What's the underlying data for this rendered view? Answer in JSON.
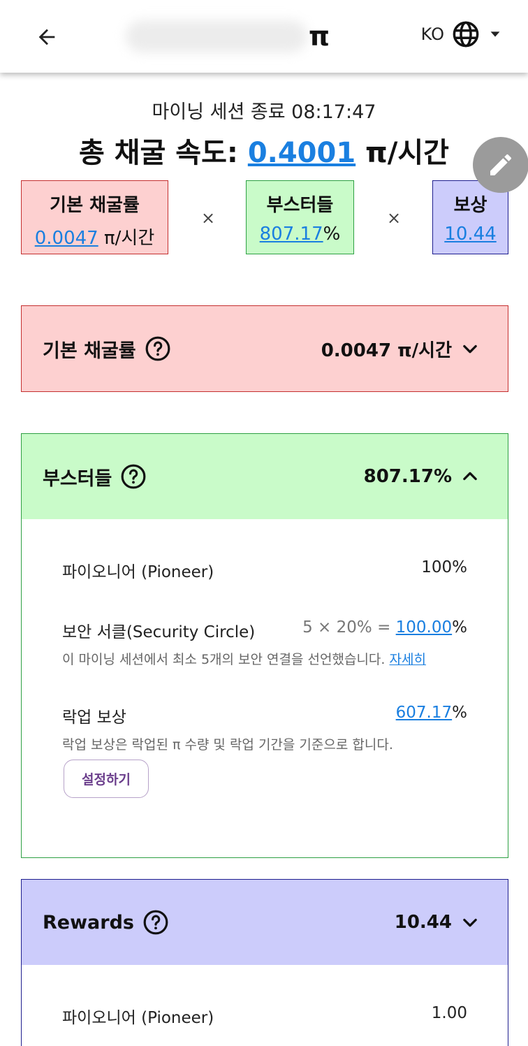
{
  "header": {
    "balance_suffix": "π",
    "language": "KO"
  },
  "session": {
    "text": "마이닝 세션 종료 08:17:47"
  },
  "total": {
    "label": "총 채굴 속도:",
    "value": "0.4001",
    "unit": "π/시간"
  },
  "summary": {
    "base": {
      "title": "기본 채굴률",
      "value": "0.0047",
      "unit": "π/시간"
    },
    "boosters": {
      "title": "부스터들",
      "value": "807.17",
      "unit": "%"
    },
    "rewards": {
      "title": "보상",
      "value": "10.44"
    },
    "times": "×"
  },
  "panels": {
    "base": {
      "title": "기본 채굴률",
      "value": "0.0047 π/시간"
    },
    "boosters": {
      "title": "부스터들",
      "value": "807.17%",
      "items": {
        "pioneer": {
          "label": "파이오니어 (Pioneer)",
          "value": "100%"
        },
        "security": {
          "label": "보안 서클(Security Circle)",
          "formula": "5 × 20% = ",
          "value": "100.00",
          "unit": "%",
          "desc": "이 마이닝 세션에서 최소 5개의 보안 연결을 선언했습니다.",
          "link": "자세히"
        },
        "lockup": {
          "label": "락업 보상",
          "value": "607.17",
          "unit": "%",
          "desc": "락업 보상은 락업된 π 수량 및 락업 기간을 기준으로 합니다.",
          "button": "설정하기"
        }
      }
    },
    "rewards": {
      "title": "Rewards",
      "value": "10.44",
      "items": {
        "pioneer": {
          "label": "파이오니어 (Pioneer)",
          "value": "1.00"
        }
      }
    }
  },
  "icons": {
    "back": "arrow-left-icon",
    "language": "globe-icon",
    "dropdown": "caret-down-icon",
    "edit": "pencil-icon",
    "help": "question-circle-icon",
    "expand": "chevron-down-icon",
    "collapse": "chevron-up-icon"
  },
  "colors": {
    "link": "#1a7fe0",
    "base_bg": "#fdd0d0",
    "base_border": "#c53030",
    "boost_bg": "#c9fbc9",
    "boost_border": "#2ea043",
    "reward_bg": "#ccccfb",
    "reward_border": "#1f1f8f",
    "button_text": "#6b3e8c"
  }
}
